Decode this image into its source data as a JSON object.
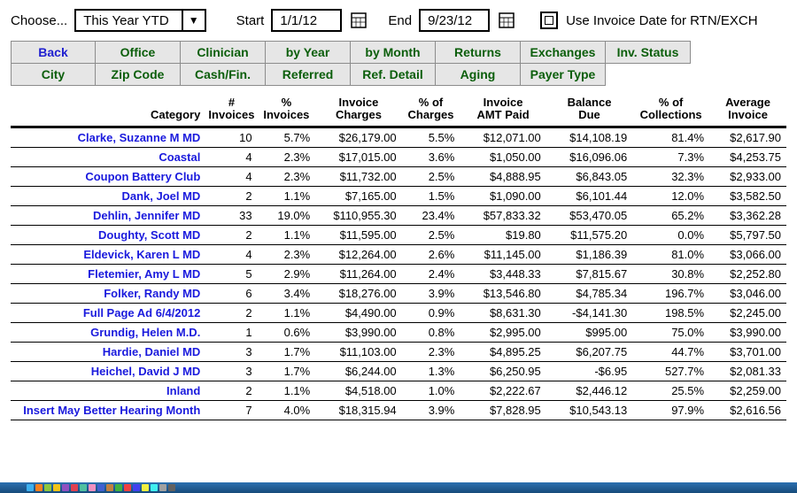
{
  "toolbar": {
    "choose_label": "Choose...",
    "range_value": "This Year YTD",
    "start_label": "Start",
    "start_value": "1/1/12",
    "end_label": "End",
    "end_value": "9/23/12",
    "checkbox_label": "Use Invoice Date for RTN/EXCH"
  },
  "tabs": {
    "row1": [
      "Back",
      "Office",
      "Clinician",
      "by Year",
      "by Month",
      "Returns",
      "Exchanges",
      "Inv. Status"
    ],
    "row2": [
      "City",
      "Zip Code",
      "Cash/Fin.",
      "Referred",
      "Ref. Detail",
      "Aging",
      "Payer Type"
    ]
  },
  "columns": {
    "category": "Category",
    "num_invoices": "#\nInvoices",
    "pct_invoices": "%\nInvoices",
    "inv_charges": "Invoice\nCharges",
    "pct_charges": "% of\nCharges",
    "amt_paid": "Invoice\nAMT Paid",
    "balance": "Balance\nDue",
    "pct_coll": "% of\nCollections",
    "avg_inv": "Average\nInvoice"
  },
  "rows": [
    {
      "cat": "Clarke, Suzanne M MD",
      "n": "10",
      "pi": "5.7%",
      "chg": "$26,179.00",
      "pc": "5.5%",
      "paid": "$12,071.00",
      "bal": "$14,108.19",
      "pcoll": "81.4%",
      "avg": "$2,617.90"
    },
    {
      "cat": "Coastal",
      "n": "4",
      "pi": "2.3%",
      "chg": "$17,015.00",
      "pc": "3.6%",
      "paid": "$1,050.00",
      "bal": "$16,096.06",
      "pcoll": "7.3%",
      "avg": "$4,253.75"
    },
    {
      "cat": "Coupon Battery Club",
      "n": "4",
      "pi": "2.3%",
      "chg": "$11,732.00",
      "pc": "2.5%",
      "paid": "$4,888.95",
      "bal": "$6,843.05",
      "pcoll": "32.3%",
      "avg": "$2,933.00"
    },
    {
      "cat": "Dank, Joel MD",
      "n": "2",
      "pi": "1.1%",
      "chg": "$7,165.00",
      "pc": "1.5%",
      "paid": "$1,090.00",
      "bal": "$6,101.44",
      "pcoll": "12.0%",
      "avg": "$3,582.50"
    },
    {
      "cat": "Dehlin, Jennifer MD",
      "n": "33",
      "pi": "19.0%",
      "chg": "$110,955.30",
      "pc": "23.4%",
      "paid": "$57,833.32",
      "bal": "$53,470.05",
      "pcoll": "65.2%",
      "avg": "$3,362.28"
    },
    {
      "cat": "Doughty, Scott MD",
      "n": "2",
      "pi": "1.1%",
      "chg": "$11,595.00",
      "pc": "2.5%",
      "paid": "$19.80",
      "bal": "$11,575.20",
      "pcoll": "0.0%",
      "avg": "$5,797.50"
    },
    {
      "cat": "Eldevick, Karen L MD",
      "n": "4",
      "pi": "2.3%",
      "chg": "$12,264.00",
      "pc": "2.6%",
      "paid": "$11,145.00",
      "bal": "$1,186.39",
      "pcoll": "81.0%",
      "avg": "$3,066.00"
    },
    {
      "cat": "Fletemier, Amy L MD",
      "n": "5",
      "pi": "2.9%",
      "chg": "$11,264.00",
      "pc": "2.4%",
      "paid": "$3,448.33",
      "bal": "$7,815.67",
      "pcoll": "30.8%",
      "avg": "$2,252.80"
    },
    {
      "cat": "Folker, Randy MD",
      "n": "6",
      "pi": "3.4%",
      "chg": "$18,276.00",
      "pc": "3.9%",
      "paid": "$13,546.80",
      "bal": "$4,785.34",
      "pcoll": "196.7%",
      "avg": "$3,046.00"
    },
    {
      "cat": "Full Page Ad 6/4/2012",
      "n": "2",
      "pi": "1.1%",
      "chg": "$4,490.00",
      "pc": "0.9%",
      "paid": "$8,631.30",
      "bal": "-$4,141.30",
      "pcoll": "198.5%",
      "avg": "$2,245.00"
    },
    {
      "cat": "Grundig, Helen M.D.",
      "n": "1",
      "pi": "0.6%",
      "chg": "$3,990.00",
      "pc": "0.8%",
      "paid": "$2,995.00",
      "bal": "$995.00",
      "pcoll": "75.0%",
      "avg": "$3,990.00"
    },
    {
      "cat": "Hardie, Daniel MD",
      "n": "3",
      "pi": "1.7%",
      "chg": "$11,103.00",
      "pc": "2.3%",
      "paid": "$4,895.25",
      "bal": "$6,207.75",
      "pcoll": "44.7%",
      "avg": "$3,701.00"
    },
    {
      "cat": "Heichel, David J MD",
      "n": "3",
      "pi": "1.7%",
      "chg": "$6,244.00",
      "pc": "1.3%",
      "paid": "$6,250.95",
      "bal": "-$6.95",
      "pcoll": "527.7%",
      "avg": "$2,081.33"
    },
    {
      "cat": "Inland",
      "n": "2",
      "pi": "1.1%",
      "chg": "$4,518.00",
      "pc": "1.0%",
      "paid": "$2,222.67",
      "bal": "$2,446.12",
      "pcoll": "25.5%",
      "avg": "$2,259.00"
    },
    {
      "cat": "Insert May Better Hearing Month",
      "n": "7",
      "pi": "4.0%",
      "chg": "$18,315.94",
      "pc": "3.9%",
      "paid": "$7,828.95",
      "bal": "$10,543.13",
      "pcoll": "97.9%",
      "avg": "$2,616.56"
    }
  ],
  "taskbar_colors": [
    "#3cb0f0",
    "#f58020",
    "#8cc63f",
    "#f0c419",
    "#9050c0",
    "#e04050",
    "#50c0a0",
    "#f090c0",
    "#4060d0",
    "#c08040",
    "#40b040",
    "#f04040",
    "#4040f0",
    "#f0f040",
    "#40f0f0",
    "#a0a0a0",
    "#606060"
  ]
}
